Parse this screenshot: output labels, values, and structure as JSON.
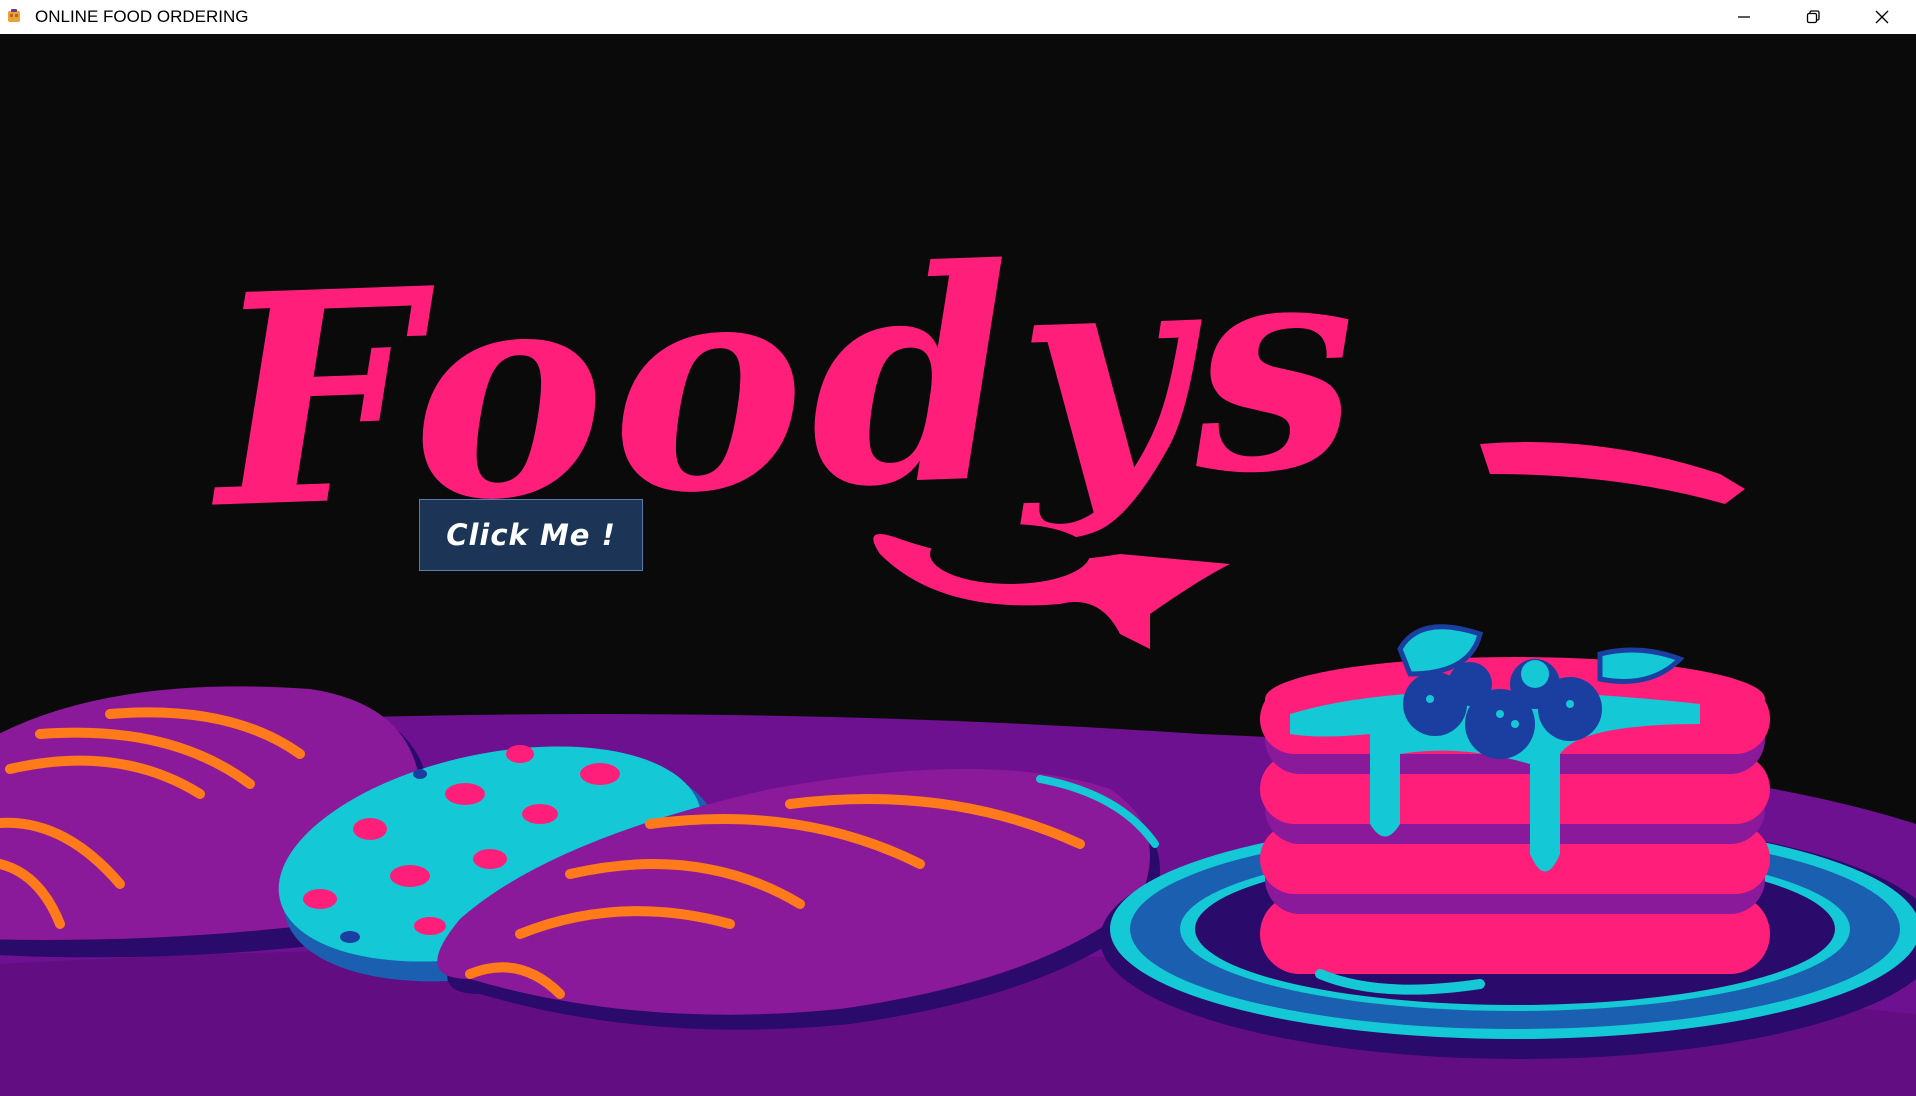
{
  "window": {
    "title": "ONLINE FOOD ORDERING",
    "app_icon": "food-app-icon",
    "controls": {
      "minimize_icon": "minimize-icon",
      "restore_icon": "restore-icon",
      "close_icon": "close-icon"
    }
  },
  "hero": {
    "logo_text": "Foodys",
    "logo_color": "#ff1f7a",
    "background_color": "#0a0a0a",
    "table_color": "#6e1190",
    "accent_cyan": "#14c8d6",
    "accent_orange": "#ff7a1a"
  },
  "main": {
    "cta_button_label": "Click Me !",
    "cta_button_color": "#1c3557"
  }
}
